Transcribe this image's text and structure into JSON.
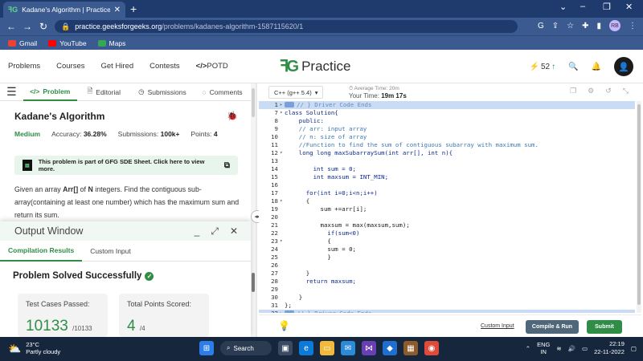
{
  "browser": {
    "tab_title": "Kadane's Algorithm | Practice | G",
    "url_host": "practice.geeksforgeeks.org",
    "url_path": "/problems/kadanes-algorithm-1587115620/1",
    "profile_initials": "RB",
    "bookmarks": [
      "Gmail",
      "YouTube",
      "Maps"
    ]
  },
  "gfg_nav": {
    "links": [
      "Problems",
      "Courses",
      "Get Hired",
      "Contests",
      "POTD"
    ],
    "brand": "Practice",
    "streak": "52"
  },
  "left_tabs": [
    "Problem",
    "Editorial",
    "Submissions",
    "Comments"
  ],
  "problem": {
    "title": "Kadane's Algorithm",
    "level": "Medium",
    "accuracy_label": "Accuracy:",
    "accuracy": "36.28%",
    "submissions_label": "Submissions:",
    "submissions": "100k+",
    "points_label": "Points:",
    "points": "4",
    "sde_banner": "This problem is part of GFG SDE Sheet. Click here to view more.",
    "description_parts": [
      "Given an array ",
      "Arr[]",
      " of ",
      "N",
      " integers. Find the contiguous sub-array(containing at least one number) which has the maximum sum and return its sum."
    ]
  },
  "output": {
    "title": "Output Window",
    "tabs": [
      "Compilation Results",
      "Custom Input"
    ],
    "status": "Problem Solved Successfully",
    "cards": [
      {
        "label": "Test Cases Passed:",
        "value": "10133",
        "total": "/10133"
      },
      {
        "label": "Total Points Scored:",
        "value": "4",
        "total": "/4"
      }
    ]
  },
  "editor": {
    "language": "C++ (g++ 5.4)",
    "avg_time_label": "Average Time:",
    "avg_time": "20m",
    "your_time_label": "Your Time:",
    "your_time": "19m 17s",
    "custom_input": "Custom Input",
    "compile_run": "Compile & Run",
    "submit": "Submit",
    "lines": [
      {
        "n": "1",
        "f": "▸",
        "t": "// } Driver Code Ends",
        "c": "dim",
        "hl": true,
        "marker": true
      },
      {
        "n": "7",
        "f": "▾",
        "t": "class Solution{",
        "c": "kw"
      },
      {
        "n": "8",
        "f": "",
        "t": "    public:",
        "c": "kw"
      },
      {
        "n": "9",
        "f": "",
        "t": "    // arr: input array",
        "c": "cmt"
      },
      {
        "n": "10",
        "f": "",
        "t": "    // n: size of array",
        "c": "cmt"
      },
      {
        "n": "11",
        "f": "",
        "t": "    //Function to find the sum of contiguous subarray with maximum sum.",
        "c": "cmt"
      },
      {
        "n": "12",
        "f": "▾",
        "t": "    long long maxSubarraySum(int arr[], int n){",
        "c": "kw"
      },
      {
        "n": "13",
        "f": "",
        "t": "",
        "c": ""
      },
      {
        "n": "14",
        "f": "",
        "t": "        int sum = 0;",
        "c": "kw"
      },
      {
        "n": "15",
        "f": "",
        "t": "        int maxsum = INT_MIN;",
        "c": "kw"
      },
      {
        "n": "16",
        "f": "",
        "t": "",
        "c": ""
      },
      {
        "n": "17",
        "f": "",
        "t": "      for(int i=0;i<n;i++)",
        "c": "kw"
      },
      {
        "n": "18",
        "f": "▾",
        "t": "      {",
        "c": ""
      },
      {
        "n": "19",
        "f": "",
        "t": "          sum +=arr[i];",
        "c": ""
      },
      {
        "n": "20",
        "f": "",
        "t": "",
        "c": ""
      },
      {
        "n": "21",
        "f": "",
        "t": "          maxsum = max(maxsum,sum);",
        "c": ""
      },
      {
        "n": "22",
        "f": "",
        "t": "            if(sum<0)",
        "c": "kw"
      },
      {
        "n": "23",
        "f": "▾",
        "t": "            {",
        "c": ""
      },
      {
        "n": "24",
        "f": "",
        "t": "            sum = 0;",
        "c": ""
      },
      {
        "n": "25",
        "f": "",
        "t": "            }",
        "c": ""
      },
      {
        "n": "26",
        "f": "",
        "t": "",
        "c": ""
      },
      {
        "n": "27",
        "f": "",
        "t": "      }",
        "c": ""
      },
      {
        "n": "28",
        "f": "",
        "t": "      return maxsum;",
        "c": "kw"
      },
      {
        "n": "29",
        "f": "",
        "t": "",
        "c": ""
      },
      {
        "n": "30",
        "f": "",
        "t": "    }",
        "c": ""
      },
      {
        "n": "31",
        "f": "",
        "t": "};",
        "c": ""
      },
      {
        "n": "32",
        "f": "▸",
        "t": "// } Driver Code Ends",
        "c": "dim",
        "hl": true,
        "marker": true
      }
    ]
  },
  "taskbar": {
    "temp": "23°C",
    "weather": "Partly cloudy",
    "search": "Search",
    "lang_top": "ENG",
    "lang_bottom": "IN",
    "time": "22:19",
    "date": "22-11-2022"
  },
  "colors": {
    "brand_green": "#2f8d46",
    "chrome_blue": "#3b5a8f",
    "run_button": "#4f6778"
  }
}
